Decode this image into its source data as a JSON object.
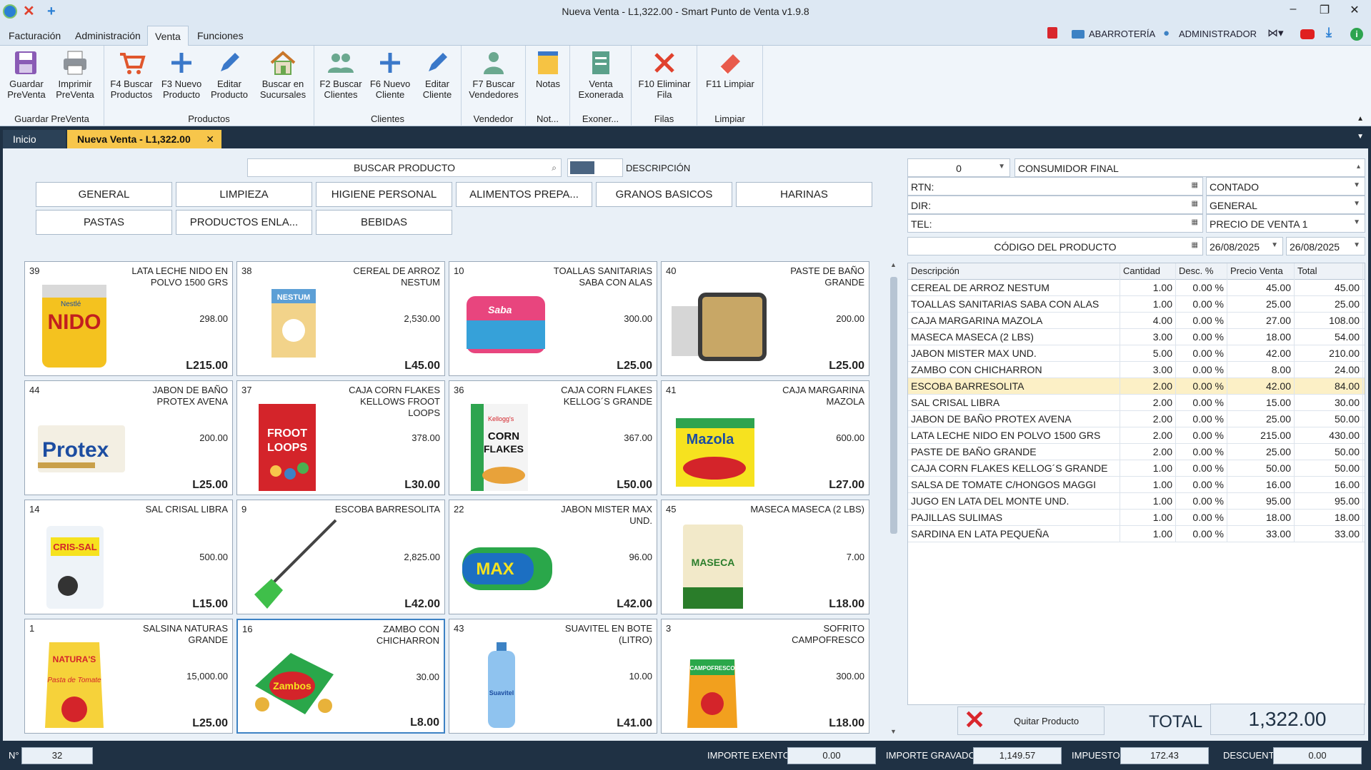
{
  "window": {
    "title": "Nueva Venta - L1,322.00 - Smart Punto de Venta v1.9.8"
  },
  "menu": [
    "Facturación",
    "Administración",
    "Venta",
    "Funciones"
  ],
  "menu_right": {
    "store": "ABARROTERÍA",
    "user": "ADMINISTRADOR"
  },
  "ribbon": {
    "groups": [
      "Guardar PreVenta",
      "Productos",
      "Clientes",
      "Vendedor",
      "Not...",
      "Exoner...",
      "Filas",
      "Limpiar"
    ],
    "buttons": [
      {
        "l1": "Guardar",
        "l2": "PreVenta"
      },
      {
        "l1": "Imprimir",
        "l2": "PreVenta"
      },
      {
        "l1": "F4 Buscar",
        "l2": "Productos"
      },
      {
        "l1": "F3 Nuevo",
        "l2": "Producto"
      },
      {
        "l1": "Editar",
        "l2": "Producto"
      },
      {
        "l1": "Buscar en",
        "l2": "Sucursales"
      },
      {
        "l1": "F2 Buscar",
        "l2": "Clientes"
      },
      {
        "l1": "F6 Nuevo",
        "l2": "Cliente"
      },
      {
        "l1": "Editar",
        "l2": "Cliente"
      },
      {
        "l1": "F7 Buscar",
        "l2": "Vendedores"
      },
      {
        "l1": "Notas",
        "l2": ""
      },
      {
        "l1": "Venta",
        "l2": "Exonerada"
      },
      {
        "l1": "F10 Eliminar",
        "l2": "Fila"
      },
      {
        "l1": "F11 Limpiar",
        "l2": ""
      }
    ]
  },
  "tabs": {
    "home": "Inicio",
    "active": "Nueva Venta - L1,322.00"
  },
  "search": {
    "label": "BUSCAR PRODUCTO",
    "toggle_label": "DESCRIPCIÓN"
  },
  "categories": [
    "GENERAL",
    "LIMPIEZA",
    "HIGIENE PERSONAL",
    "ALIMENTOS PREPA...",
    "GRANOS BASICOS",
    "HARINAS",
    "PASTAS",
    "PRODUCTOS ENLA...",
    "BEBIDAS"
  ],
  "products": [
    {
      "id": "39",
      "name": "LATA LECHE NIDO EN POLVO 1500 GRS",
      "stock": "298.00",
      "price": "L215.00"
    },
    {
      "id": "38",
      "name": "CEREAL DE ARROZ NESTUM",
      "stock": "2,530.00",
      "price": "L45.00"
    },
    {
      "id": "10",
      "name": "TOALLAS SANITARIAS SABA CON ALAS",
      "stock": "300.00",
      "price": "L25.00"
    },
    {
      "id": "40",
      "name": "PASTE DE BAÑO GRANDE",
      "stock": "200.00",
      "price": "L25.00"
    },
    {
      "id": "44",
      "name": "JABON DE BAÑO PROTEX AVENA",
      "stock": "200.00",
      "price": "L25.00"
    },
    {
      "id": "37",
      "name": "CAJA CORN FLAKES KELLOWS FROOT LOOPS",
      "stock": "378.00",
      "price": "L30.00"
    },
    {
      "id": "36",
      "name": "CAJA CORN FLAKES KELLOG´S GRANDE",
      "stock": "367.00",
      "price": "L50.00"
    },
    {
      "id": "41",
      "name": "CAJA MARGARINA MAZOLA",
      "stock": "600.00",
      "price": "L27.00"
    },
    {
      "id": "14",
      "name": "SAL CRISAL LIBRA",
      "stock": "500.00",
      "price": "L15.00"
    },
    {
      "id": "9",
      "name": "ESCOBA BARRESOLITA",
      "stock": "2,825.00",
      "price": "L42.00"
    },
    {
      "id": "22",
      "name": "JABON MISTER MAX UND.",
      "stock": "96.00",
      "price": "L42.00"
    },
    {
      "id": "45",
      "name": "MASECA MASECA (2 LBS)",
      "stock": "7.00",
      "price": "L18.00"
    },
    {
      "id": "1",
      "name": "SALSINA NATURAS GRANDE",
      "stock": "15,000.00",
      "price": "L25.00"
    },
    {
      "id": "16",
      "name": "ZAMBO CON CHICHARRON",
      "stock": "30.00",
      "price": "L8.00"
    },
    {
      "id": "43",
      "name": "SUAVITEL EN BOTE (LITRO)",
      "stock": "10.00",
      "price": "L41.00"
    },
    {
      "id": "3",
      "name": "SOFRITO CAMPOFRESCO",
      "stock": "300.00",
      "price": "L18.00"
    }
  ],
  "image_text": {
    "nido": "NIDO",
    "nestle": "Nestlé",
    "nestum": "NESTUM",
    "saba": "Saba",
    "protex": "Protex",
    "froot": "FROOT",
    "loops": "LOOPS",
    "corn": "CORN",
    "flakes": "FLAKES",
    "kellogg": "Kellogg's",
    "mazola": "Mazola",
    "crisal": "CRIS-SAL",
    "max": "MAX",
    "maseca": "MASECA",
    "naturas": "NATURA'S",
    "tomate": "Pasta de Tomate",
    "zambos": "Zambos",
    "suavitel": "Suavitel",
    "campofresco": "CAMPOFRESCO"
  },
  "customer": {
    "code": "0",
    "name": "CONSUMIDOR FINAL",
    "rtn_label": "RTN:",
    "dir_label": "DIR:",
    "tel_label": "TEL:",
    "payment": "CONTADO",
    "type": "GENERAL",
    "price_list": "PRECIO DE VENTA 1",
    "product_code_label": "CÓDIGO DEL PRODUCTO",
    "date1": "26/08/2025",
    "date2": "26/08/2025"
  },
  "grid": {
    "columns": [
      "Descripción",
      "Cantidad",
      "Desc. %",
      "Precio Venta",
      "Total"
    ],
    "rows": [
      [
        "CEREAL DE ARROZ NESTUM",
        "1.00",
        "0.00 %",
        "45.00",
        "45.00"
      ],
      [
        "TOALLAS SANITARIAS SABA CON ALAS",
        "1.00",
        "0.00 %",
        "25.00",
        "25.00"
      ],
      [
        "CAJA MARGARINA MAZOLA",
        "4.00",
        "0.00 %",
        "27.00",
        "108.00"
      ],
      [
        "MASECA MASECA (2 LBS)",
        "3.00",
        "0.00 %",
        "18.00",
        "54.00"
      ],
      [
        "JABON MISTER MAX UND.",
        "5.00",
        "0.00 %",
        "42.00",
        "210.00"
      ],
      [
        "ZAMBO CON CHICHARRON",
        "3.00",
        "0.00 %",
        "8.00",
        "24.00"
      ],
      [
        "ESCOBA BARRESOLITA",
        "2.00",
        "0.00 %",
        "42.00",
        "84.00"
      ],
      [
        "SAL CRISAL LIBRA",
        "2.00",
        "0.00 %",
        "15.00",
        "30.00"
      ],
      [
        "JABON DE BAÑO PROTEX AVENA",
        "2.00",
        "0.00 %",
        "25.00",
        "50.00"
      ],
      [
        "LATA LECHE NIDO EN POLVO 1500 GRS",
        "2.00",
        "0.00 %",
        "215.00",
        "430.00"
      ],
      [
        "PASTE DE BAÑO GRANDE",
        "2.00",
        "0.00 %",
        "25.00",
        "50.00"
      ],
      [
        "CAJA CORN FLAKES KELLOG´S GRANDE",
        "1.00",
        "0.00 %",
        "50.00",
        "50.00"
      ],
      [
        "SALSA DE TOMATE C/HONGOS MAGGI",
        "1.00",
        "0.00 %",
        "16.00",
        "16.00"
      ],
      [
        "JUGO EN LATA DEL MONTE UND.",
        "1.00",
        "0.00 %",
        "95.00",
        "95.00"
      ],
      [
        "PAJILLAS SULIMAS",
        "1.00",
        "0.00 %",
        "18.00",
        "18.00"
      ],
      [
        "SARDINA EN LATA PEQUEÑA",
        "1.00",
        "0.00 %",
        "33.00",
        "33.00"
      ]
    ],
    "highlight_index": 6
  },
  "footer": {
    "remove_label": "Quitar Producto",
    "total_label": "TOTAL",
    "total_value": "1,322.00"
  },
  "status": {
    "num_label": "N°",
    "num_value": "32",
    "exento_label": "IMPORTE EXENTO",
    "exento_value": "0.00",
    "gravado_label": "IMPORTE GRAVADO",
    "gravado_value": "1,149.57",
    "impuesto_label": "IMPUESTO",
    "impuesto_value": "172.43",
    "descuento_label": "DESCUENTO",
    "descuento_value": "0.00"
  },
  "colors": {
    "accent": "#3d82c4",
    "dark": "#1f3144",
    "tab_active": "#f7c64b",
    "highlight": "#fcf0c6"
  }
}
